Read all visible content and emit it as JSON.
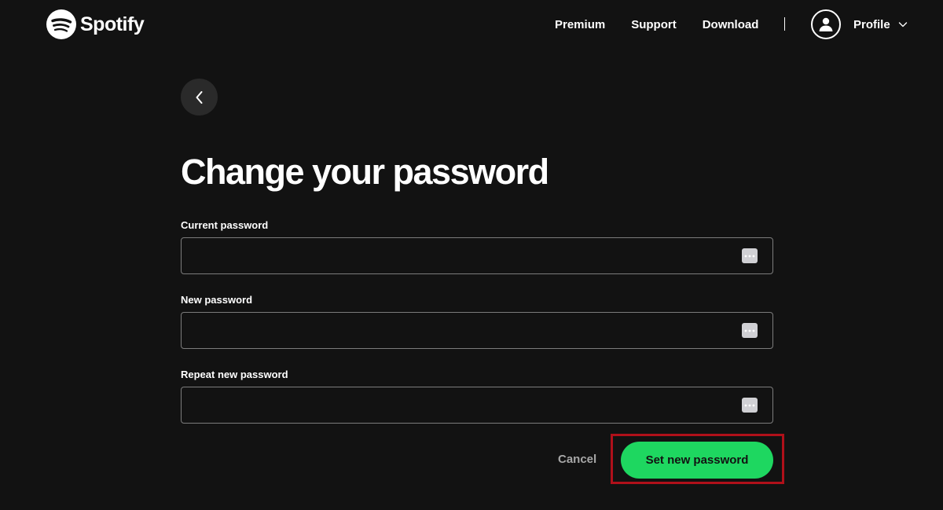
{
  "header": {
    "brand": "Spotify",
    "nav": [
      "Premium",
      "Support",
      "Download"
    ],
    "profile_label": "Profile"
  },
  "page": {
    "title": "Change your password"
  },
  "fields": [
    {
      "label": "Current password",
      "value": "",
      "placeholder": ""
    },
    {
      "label": "New password",
      "value": "",
      "placeholder": ""
    },
    {
      "label": "Repeat new password",
      "value": "",
      "placeholder": ""
    }
  ],
  "actions": {
    "cancel_label": "Cancel",
    "submit_label": "Set new password"
  },
  "colors": {
    "background": "#121212",
    "accent": "#1ed760",
    "highlight": "#b0101a"
  }
}
